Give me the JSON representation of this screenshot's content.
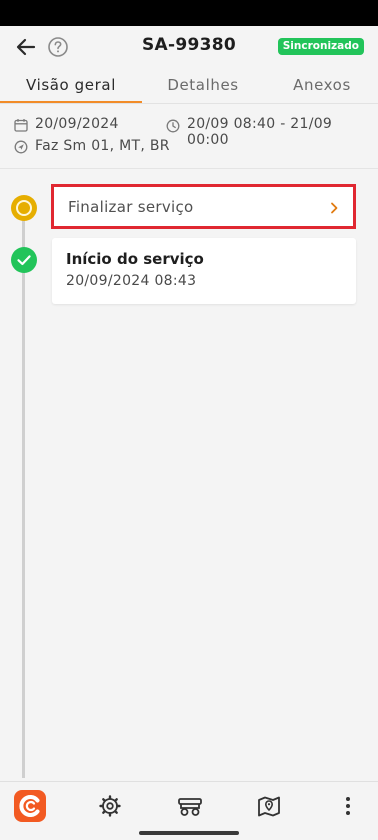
{
  "header": {
    "title": "SA-99380",
    "sync_badge": "Sincronizado",
    "back_icon": "arrow-left",
    "help_icon": "question-circle"
  },
  "tabs": [
    {
      "label": "Visão geral",
      "active": true
    },
    {
      "label": "Detalhes",
      "active": false
    },
    {
      "label": "Anexos",
      "active": false
    }
  ],
  "summary": {
    "date": "20/09/2024",
    "time_range": "20/09 08:40 - 21/09 00:00",
    "location": "Faz Sm 01, MT, BR"
  },
  "timeline": {
    "pending_step": {
      "label": "Finalizar serviço",
      "status": "pending"
    },
    "completed_step": {
      "title": "Início do serviço",
      "datetime": "20/09/2024 08:43",
      "status": "done"
    }
  },
  "bottom_nav": {
    "items": [
      "app-logo",
      "gear-icon",
      "vehicle-icon",
      "map-pin-icon",
      "more-vertical-icon"
    ]
  },
  "colors": {
    "accent": "#f28c28",
    "success": "#22c45a",
    "pending": "#e6ae00",
    "highlight_border": "#e02731",
    "logo": "#f25a22"
  }
}
